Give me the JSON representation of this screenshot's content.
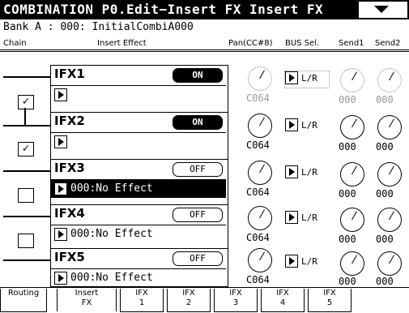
{
  "title": "COMBINATION P0.Edit−Insert FX   Insert FX",
  "bank_line": "Bank A : 000: InitialCombiA000",
  "columns": {
    "chain": "Chain",
    "insert_effect": "Insert Effect",
    "pan": "Pan(CC#8)",
    "bus_sel": "BUS Sel.",
    "send1": "Send1",
    "send2": "Send2"
  },
  "ifx": [
    {
      "label": "IFX1",
      "switch": "ON",
      "effect": "",
      "pan": "C064",
      "bus": "L/R",
      "send1": "000",
      "send2": "000"
    },
    {
      "label": "IFX2",
      "switch": "ON",
      "effect": "",
      "pan": "C064",
      "bus": "L/R",
      "send1": "000",
      "send2": "000"
    },
    {
      "label": "IFX3",
      "switch": "OFF",
      "effect": "000:No Effect",
      "pan": "C064",
      "bus": "L/R",
      "send1": "000",
      "send2": "000"
    },
    {
      "label": "IFX4",
      "switch": "OFF",
      "effect": "000:No Effect",
      "pan": "C064",
      "bus": "L/R",
      "send1": "000",
      "send2": "000"
    },
    {
      "label": "IFX5",
      "switch": "OFF",
      "effect": "000:No Effect",
      "pan": "C064",
      "bus": "L/R",
      "send1": "000",
      "send2": "000"
    }
  ],
  "tabs": [
    {
      "line1": "Routing",
      "line2": ""
    },
    {
      "line1": "Insert",
      "line2": "FX"
    },
    {
      "line1": "IFX",
      "line2": "1"
    },
    {
      "line1": "IFX",
      "line2": "2"
    },
    {
      "line1": "IFX",
      "line2": "3"
    },
    {
      "line1": "IFX",
      "line2": "4"
    },
    {
      "line1": "IFX",
      "line2": "5"
    }
  ]
}
